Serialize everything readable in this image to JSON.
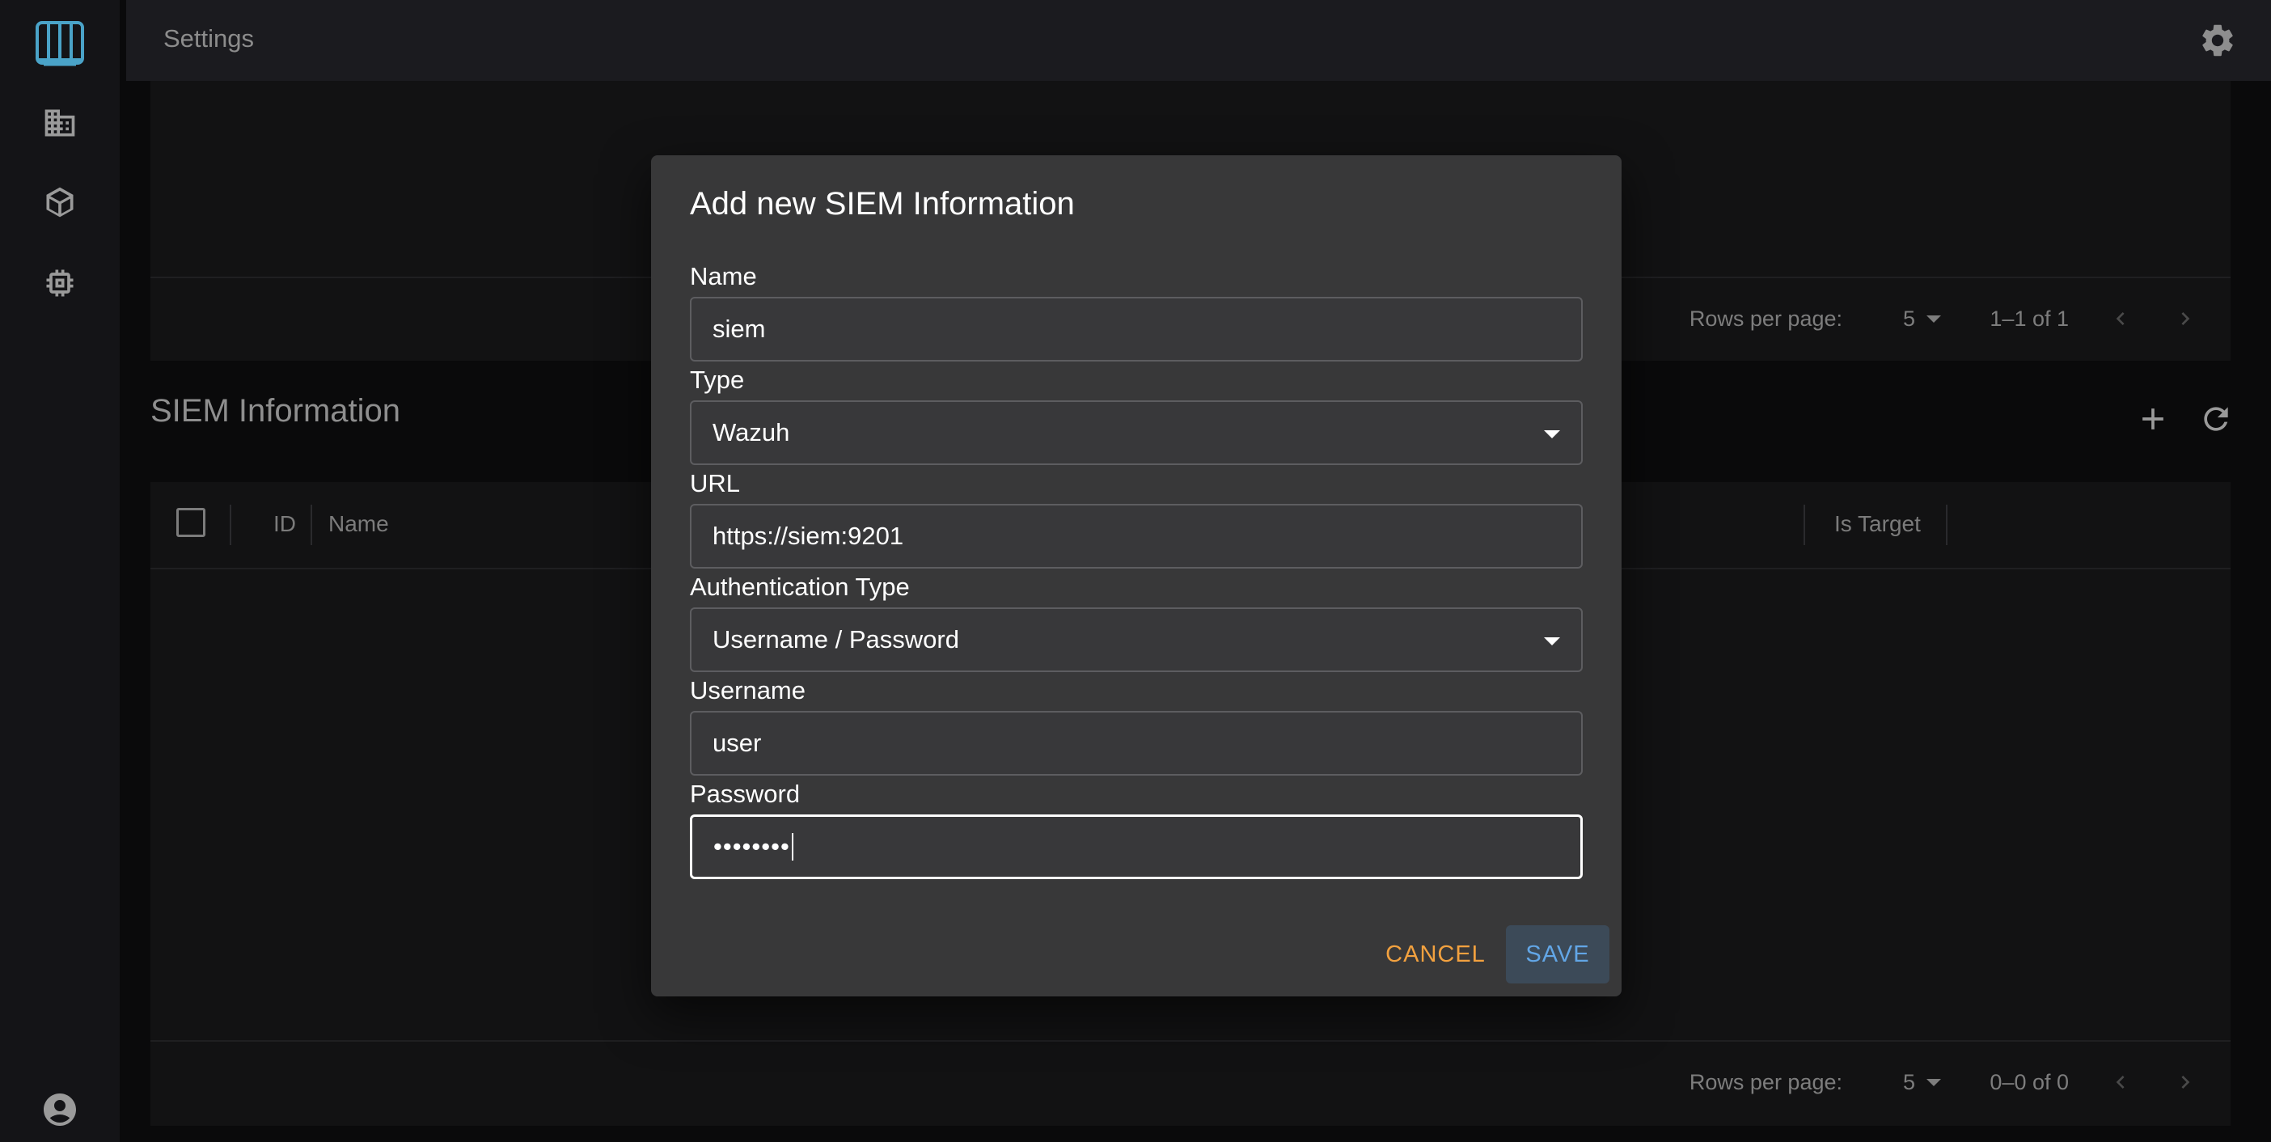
{
  "topbar": {
    "title": "Settings"
  },
  "rail": {
    "items": [
      {
        "icon": "logo-icon"
      },
      {
        "icon": "building-icon"
      },
      {
        "icon": "cube-icon"
      },
      {
        "icon": "chip-icon"
      }
    ],
    "footer_icon": "account-icon"
  },
  "top_table": {
    "rows_per_page_label": "Rows per page:",
    "rows_per_page_value": "5",
    "range": "1–1 of 1"
  },
  "siem_section": {
    "title": "SIEM Information",
    "columns": [
      "ID",
      "Name",
      "Is Target"
    ],
    "rows_per_page_label": "Rows per page:",
    "rows_per_page_value": "5",
    "range": "0–0 of 0"
  },
  "dialog": {
    "title": "Add new SIEM Information",
    "name_label": "Name",
    "name_value": "siem",
    "type_label": "Type",
    "type_value": "Wazuh",
    "url_label": "URL",
    "url_value": "https://siem:9201",
    "auth_label": "Authentication Type",
    "auth_value": "Username / Password",
    "username_label": "Username",
    "username_value": "user",
    "password_label": "Password",
    "password_masked": "••••••••",
    "cancel_label": "CANCEL",
    "save_label": "SAVE"
  },
  "colors": {
    "accent_save": "#62a6e6",
    "accent_cancel": "#f2a13f",
    "logo": "#4aa3c8"
  }
}
